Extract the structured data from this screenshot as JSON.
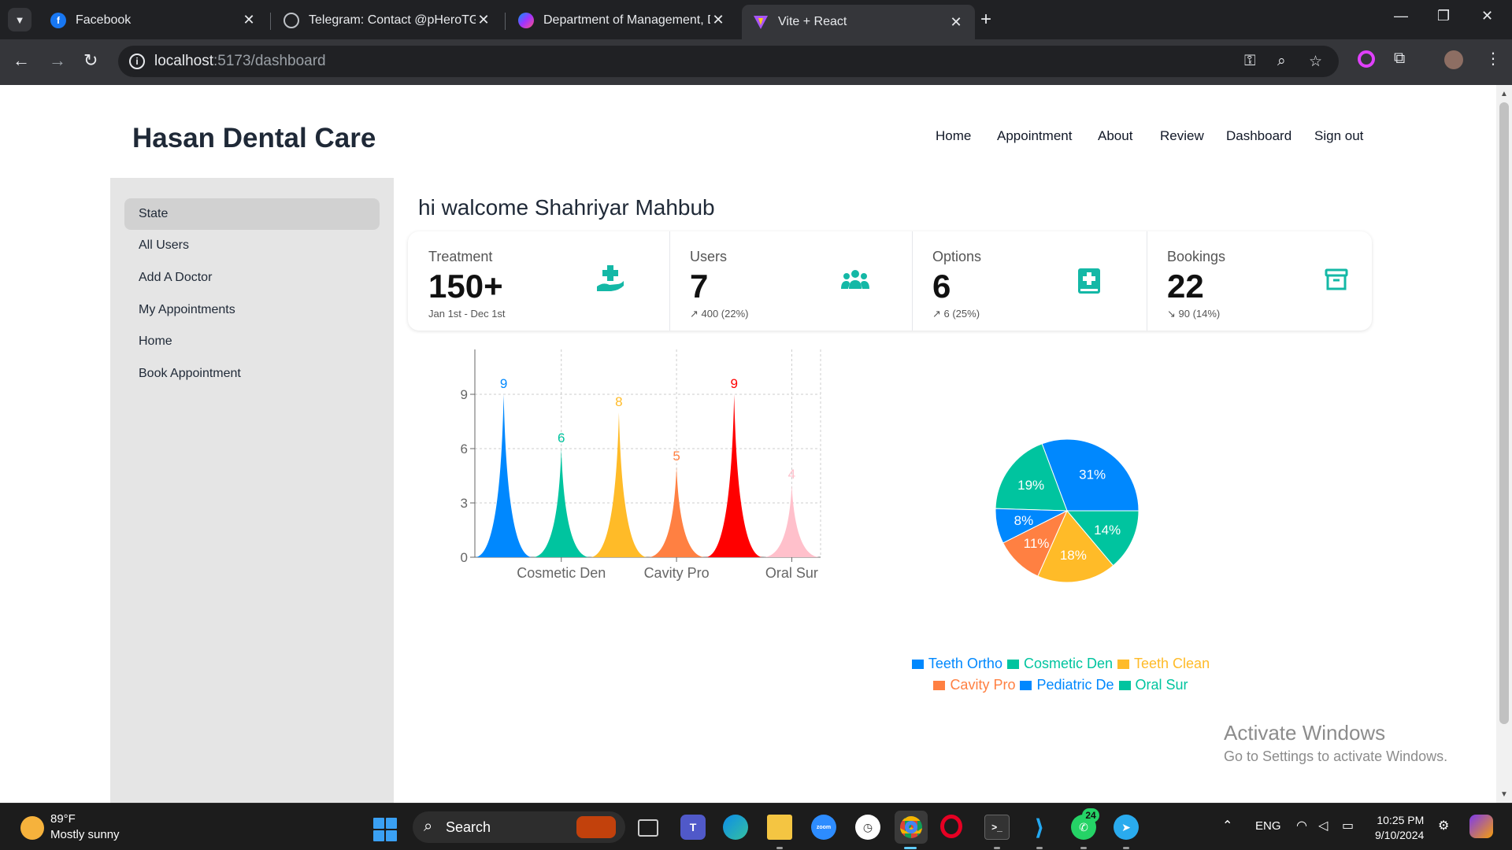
{
  "browser": {
    "tabs": [
      {
        "title": "Facebook",
        "icon": "facebook-icon"
      },
      {
        "title": "Telegram: Contact @pHeroTG",
        "icon": "globe-icon"
      },
      {
        "title": "Department of Management, D",
        "icon": "messenger-icon"
      },
      {
        "title": "Vite + React",
        "icon": "vite-icon",
        "active": true
      }
    ],
    "url_host": "localhost",
    "url_path": ":5173/dashboard"
  },
  "site": {
    "brand": "Hasan Dental Care",
    "nav": [
      "Home",
      "Appointment",
      "About",
      "Review",
      "Dashboard",
      "Sign out"
    ]
  },
  "sidebar": {
    "items": [
      "State",
      "All Users",
      "Add A Doctor",
      "My Appointments",
      "Home",
      "Book Appointment"
    ],
    "active_index": 0
  },
  "main": {
    "greeting": "hi walcome Shahriyar Mahbub",
    "stats": [
      {
        "label": "Treatment",
        "value": "150+",
        "desc": "Jan 1st - Dec 1st",
        "icon": "hand-holding-medical-icon"
      },
      {
        "label": "Users",
        "value": "7",
        "desc": "↗ 400 (22%)",
        "icon": "users-icon"
      },
      {
        "label": "Options",
        "value": "6",
        "desc": "↗ 6 (25%)",
        "icon": "medical-book-icon"
      },
      {
        "label": "Bookings",
        "value": "22",
        "desc": "↘ 90 (14%)",
        "icon": "archive-box-icon"
      }
    ]
  },
  "chart_data": [
    {
      "type": "area",
      "categories": [
        "Teeth Ortho",
        "Cosmetic Den",
        "Teeth Clean",
        "Cavity Pro",
        "Pediatric De",
        "Oral Sur"
      ],
      "values": [
        9,
        6,
        8,
        5,
        9,
        4
      ],
      "visible_tick_labels": [
        "Cosmetic Den",
        "Cavity Pro",
        "Oral Sur"
      ],
      "colors": [
        "#0088FE",
        "#00C49F",
        "#FFBB28",
        "#FF8042",
        "#FF0000",
        "#FFC0CB"
      ],
      "ylim": [
        0,
        12
      ],
      "yticks": [
        0,
        3,
        6,
        9,
        12
      ],
      "grid": true
    },
    {
      "type": "pie",
      "labels": [
        "Teeth Ortho",
        "Cosmetic Den",
        "Teeth Clean",
        "Cavity Pro",
        "Pediatric De",
        "Oral Sur"
      ],
      "values": [
        31,
        19,
        8,
        11,
        18,
        14
      ],
      "slice_order": [
        {
          "value": 31,
          "label": "31%",
          "color": "#0088FE"
        },
        {
          "value": 19,
          "label": "19%",
          "color": "#00C49F"
        },
        {
          "value": 8,
          "label": "8%",
          "color": "#0088FE"
        },
        {
          "value": 11,
          "label": "11%",
          "color": "#FF8042"
        },
        {
          "value": 18,
          "label": "18%",
          "color": "#FFBB28"
        },
        {
          "value": 14,
          "label": "14%",
          "color": "#00C49F"
        }
      ],
      "legend": [
        {
          "name": "Teeth Ortho",
          "color": "#0088FE"
        },
        {
          "name": "Cosmetic Den",
          "color": "#00C49F"
        },
        {
          "name": "Teeth Clean",
          "color": "#FFBB28"
        },
        {
          "name": "Cavity Pro",
          "color": "#FF8042"
        },
        {
          "name": "Pediatric De",
          "color": "#0088FE"
        },
        {
          "name": "Oral Sur",
          "color": "#00C49F"
        }
      ],
      "legend_position": "bottom"
    }
  ],
  "watermark": {
    "line1": "Activate Windows",
    "line2": "Go to Settings to activate Windows."
  },
  "taskbar": {
    "weather_temp": "89°F",
    "weather_desc": "Mostly sunny",
    "search_label": "Search",
    "language": "ENG",
    "time": "10:25 PM",
    "date": "9/10/2024",
    "whatsapp_badge": "24"
  }
}
